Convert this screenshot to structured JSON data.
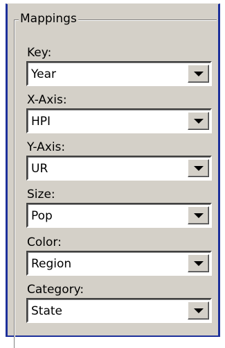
{
  "group": {
    "title": "Mappings"
  },
  "fields": [
    {
      "label": "Key:",
      "value": "Year"
    },
    {
      "label": "X-Axis:",
      "value": "HPI"
    },
    {
      "label": "Y-Axis:",
      "value": "UR"
    },
    {
      "label": "Size:",
      "value": "Pop"
    },
    {
      "label": "Color:",
      "value": "Region"
    },
    {
      "label": "Category:",
      "value": "State"
    }
  ],
  "icons": {
    "dropdown": "chevron-down-icon"
  },
  "colors": {
    "panel_bg": "#d4d0c8",
    "window_border": "#1c2f9a",
    "field_bg": "#ffffff"
  }
}
